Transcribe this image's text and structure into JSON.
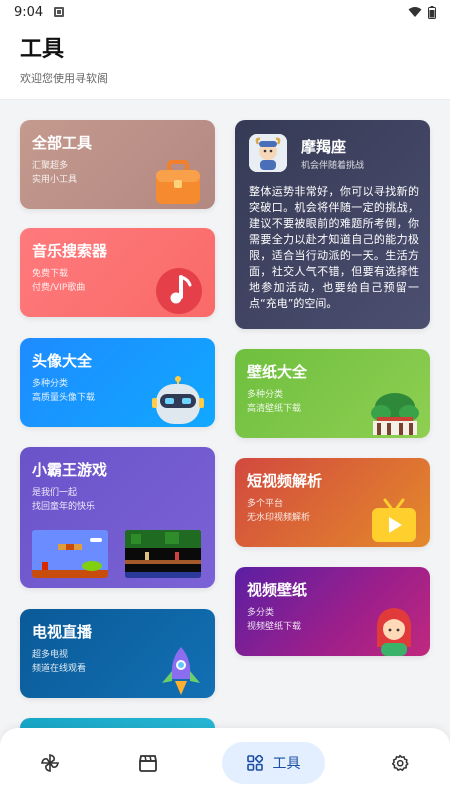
{
  "status_bar": {
    "time": "9:04"
  },
  "header": {
    "title": "工具",
    "subtitle": "欢迎您使用寻软阁"
  },
  "cards": {
    "all_tools": {
      "title": "全部工具",
      "line1": "汇聚超多",
      "line2": "实用小工具"
    },
    "music": {
      "title": "音乐搜索器",
      "line1": "免费下载",
      "line2": "付费/VIP歌曲"
    },
    "avatar": {
      "title": "头像大全",
      "line1": "多种分类",
      "line2": "高质量头像下载"
    },
    "game": {
      "title": "小霸王游戏",
      "line1": "是我们一起",
      "line2": "找回童年的快乐"
    },
    "tv": {
      "title": "电视直播",
      "line1": "超多电视",
      "line2": "频道在线观看"
    },
    "horoscope": {
      "name": "摩羯座",
      "sub": "机会伴随着挑战",
      "body": "整体运势非常好，你可以寻找新的突破口。机会将伴随一定的挑战，建议不要被眼前的难题所考倒，你需要全力以赴才知道自己的能力极限，适合当行动派的一天。生活方面，社交人气不错，但要有选择性地参加活动，也要给自己预留一点“充电”的空间。"
    },
    "wallpaper": {
      "title": "壁纸大全",
      "line1": "多种分类",
      "line2": "高清壁纸下载"
    },
    "short_video": {
      "title": "短视频解析",
      "line1": "多个平台",
      "line2": "无水印视频解析"
    },
    "video_wallpaper": {
      "title": "视频壁纸",
      "line1": "多分类",
      "line2": "视频壁纸下载"
    }
  },
  "bottom_nav": {
    "items": [
      {
        "icon": "pinwheel-icon"
      },
      {
        "icon": "clapperboard-icon"
      },
      {
        "icon": "grid-icon",
        "label": "工具",
        "active": true
      },
      {
        "icon": "gear-icon"
      }
    ]
  },
  "colors": {
    "active_nav_bg": "#e3efff",
    "active_nav_text": "#1a4fa3",
    "all_tools": "#b98f86",
    "music": "#fb7073",
    "avatar": "#1896ff",
    "game": "#6f58cd",
    "tv": "#0d64a6",
    "horoscope": "#3f4362",
    "wallpaper": "#7cc647",
    "short_video": "#dc6a35",
    "video_wallpaper": "#8a1f93"
  }
}
